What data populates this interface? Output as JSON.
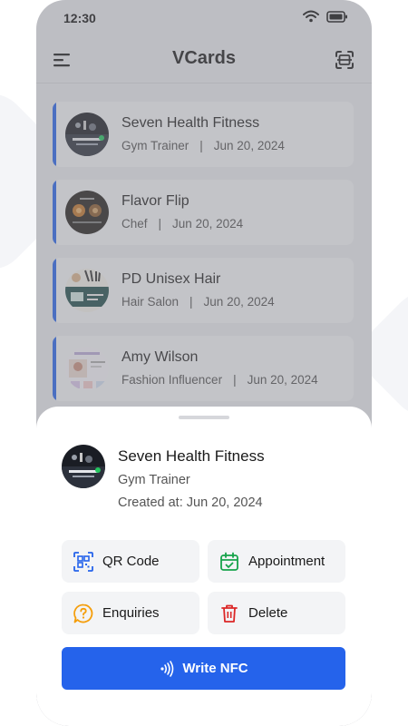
{
  "status_bar": {
    "time": "12:30"
  },
  "header": {
    "title": "VCards"
  },
  "vcards": [
    {
      "name": "Seven Health Fitness",
      "role": "Gym Trainer",
      "separator": "|",
      "date": "Jun 20, 2024"
    },
    {
      "name": "Flavor Flip",
      "role": "Chef",
      "separator": "|",
      "date": "Jun 20, 2024"
    },
    {
      "name": "PD Unisex Hair",
      "role": "Hair Salon",
      "separator": "|",
      "date": "Jun 20, 2024"
    },
    {
      "name": "Amy Wilson",
      "role": "Fashion Influencer",
      "separator": "|",
      "date": "Jun 20, 2024"
    }
  ],
  "sheet": {
    "name": "Seven Health Fitness",
    "role": "Gym Trainer",
    "created": "Created at: Jun 20, 2024",
    "actions": {
      "qr_code": "QR Code",
      "appointment": "Appointment",
      "enquiries": "Enquiries",
      "delete": "Delete"
    },
    "write_nfc": "Write NFC"
  },
  "colors": {
    "accent": "#2563eb",
    "qr": "#2563eb",
    "appointment": "#16a34a",
    "enquiries": "#f59e0b",
    "delete": "#dc2626"
  }
}
